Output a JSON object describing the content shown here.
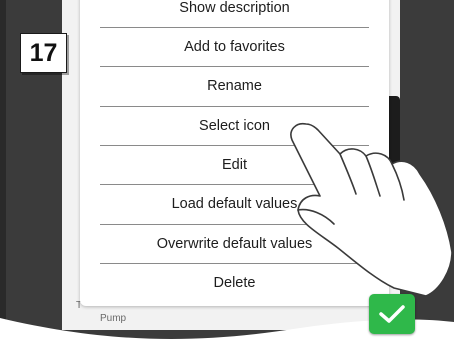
{
  "step": {
    "number": "17"
  },
  "menu": {
    "items": [
      {
        "label": "Show description"
      },
      {
        "label": "Add to favorites"
      },
      {
        "label": "Rename"
      },
      {
        "label": "Select icon"
      },
      {
        "label": "Edit"
      },
      {
        "label": "Load default values"
      },
      {
        "label": "Overwrite default values"
      },
      {
        "label": "Delete"
      }
    ]
  },
  "background": {
    "text_1": "T",
    "text_2": "Pump"
  },
  "confirm": {
    "icon": "checkmark-icon",
    "color": "#2fb84a"
  },
  "colors": {
    "frame": "#3b3b3b",
    "menu_bg": "#ffffff",
    "divider": "#8a8a8a"
  }
}
